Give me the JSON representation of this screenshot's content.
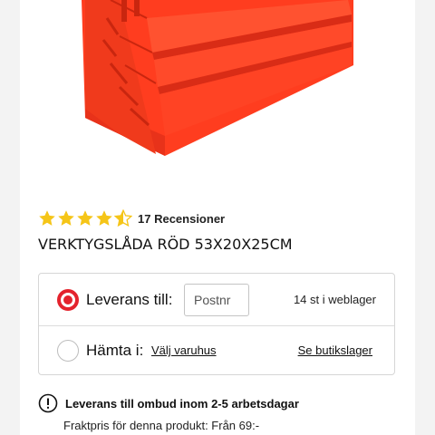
{
  "product": {
    "title": "VERKTYGSLÅDA RÖD 53X20X25CM",
    "rating": 4.5,
    "rating_max": 5,
    "review_count_text": "17 Recensioner",
    "image_color": "#ff3d1f"
  },
  "delivery": {
    "delivery_option": {
      "label": "Leverans till:",
      "selected": true,
      "postal_placeholder": "Postnr",
      "postal_value": "",
      "stock_text": "14 st i weblager"
    },
    "pickup_option": {
      "label": "Hämta i:",
      "selected": false,
      "store_link": "Välj varuhus",
      "stock_link": "Se butikslager"
    }
  },
  "info": {
    "icon": "exclamation-circle-icon",
    "delivery_note": "Leverans till ombud inom 2-5 arbetsdagar",
    "shipping_price": "Fraktpris för denna produkt: Från 69:-"
  },
  "colors": {
    "accent": "#e4232d",
    "star": "#f5c518",
    "border": "#d6d6d6"
  }
}
